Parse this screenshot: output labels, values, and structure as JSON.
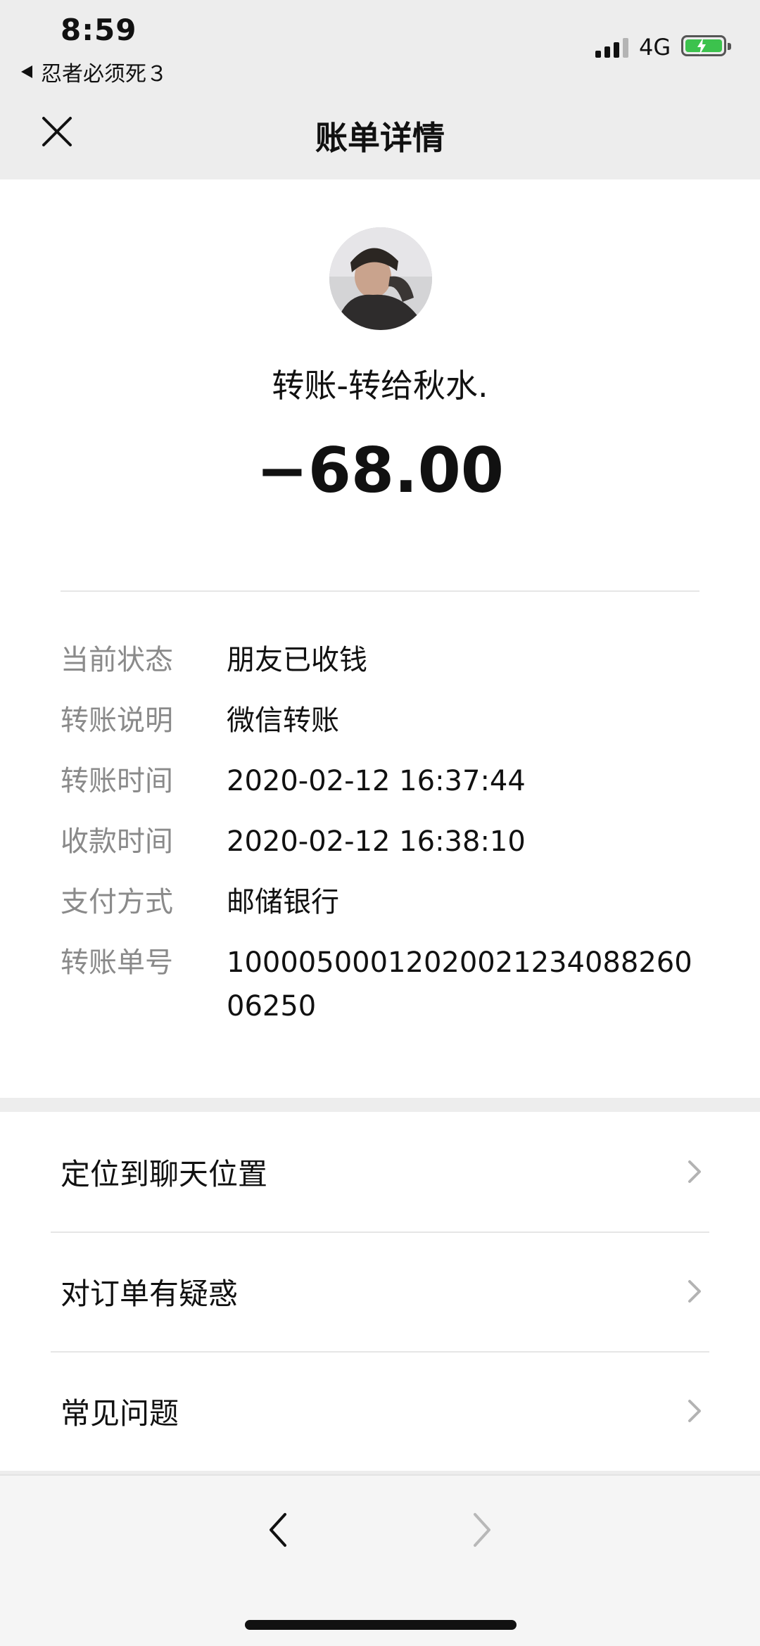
{
  "status_bar": {
    "time": "8:59",
    "back_app_label": "忍者必须死３",
    "network": "4G"
  },
  "nav": {
    "title": "账单详情"
  },
  "transfer": {
    "payee_text": "转账-转给秋水.",
    "amount": "−68.00"
  },
  "details": [
    {
      "label": "当前状态",
      "value": "朋友已收钱"
    },
    {
      "label": "转账说明",
      "value": "微信转账"
    },
    {
      "label": "转账时间",
      "value": "2020-02-12 16:37:44"
    },
    {
      "label": "收款时间",
      "value": "2020-02-12 16:38:10"
    },
    {
      "label": "支付方式",
      "value": "邮储银行"
    },
    {
      "label": "转账单号",
      "value": "10000500012020021234088260​06250"
    }
  ],
  "menu": [
    {
      "label": "定位到聊天位置"
    },
    {
      "label": "对订单有疑惑"
    },
    {
      "label": "常见问题"
    }
  ],
  "colors": {
    "page_bg": "#ededed",
    "card_bg": "#ffffff",
    "label_gray": "#8a8a8a",
    "battery_green": "#3cc24d"
  }
}
